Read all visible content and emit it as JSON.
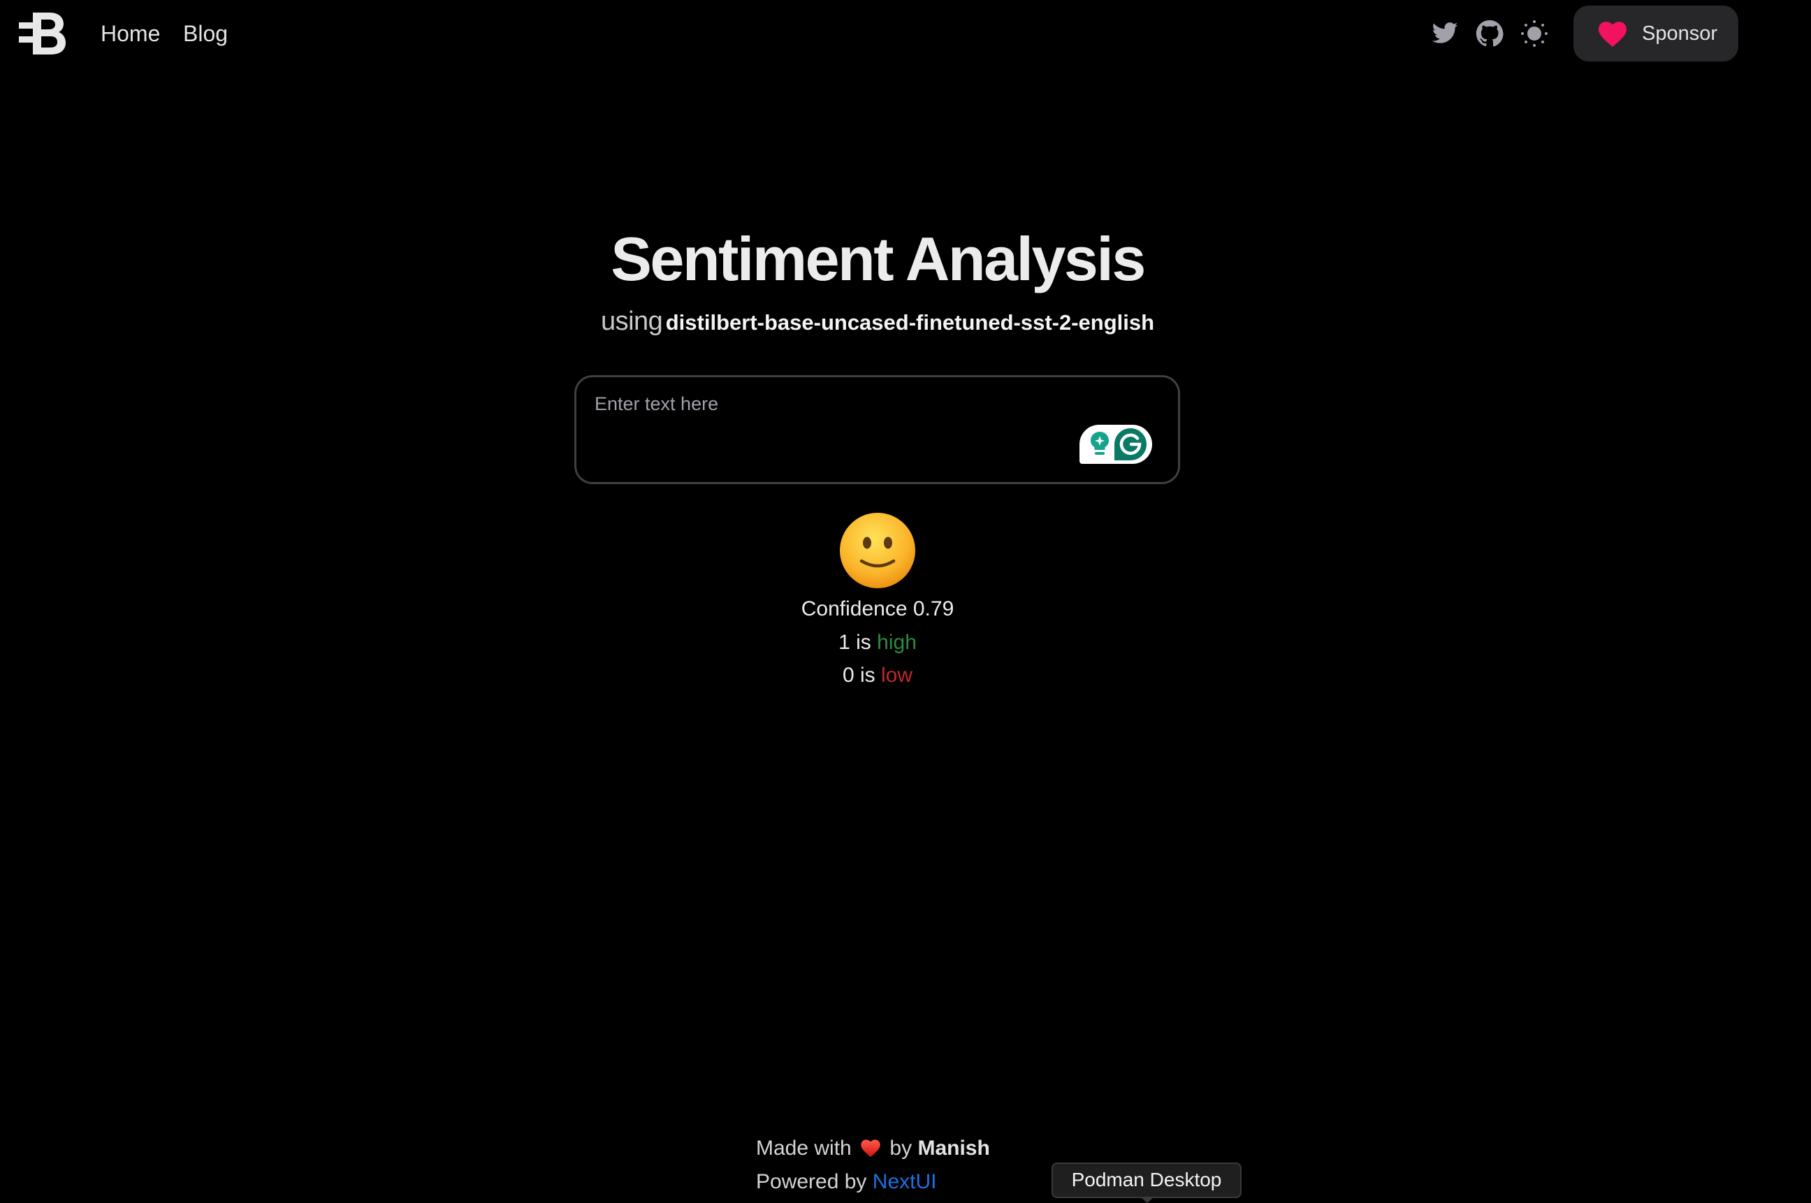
{
  "header": {
    "logo_icon": "letter-b-logo-icon",
    "nav": [
      {
        "label": "Home"
      },
      {
        "label": "Blog"
      }
    ],
    "icons": [
      "twitter-icon",
      "github-icon",
      "theme-toggle-sun-icon"
    ],
    "sponsor": {
      "label": "Sponsor",
      "icon": "heart-icon",
      "heart_color": "#f31260"
    }
  },
  "main": {
    "title": "Sentiment Analysis",
    "subtitle_prefix": "using",
    "model_name": "distilbert-base-uncased-finetuned-sst-2-english",
    "input": {
      "value": "",
      "placeholder": "Enter text here",
      "extension_widget": "grammarly-widget"
    },
    "result": {
      "emoji": "slightly-smiling-face",
      "confidence_label": "Confidence",
      "confidence_value": "0.79",
      "high_prefix": "1 is",
      "high_word": "high",
      "high_color": "#2f8a3c",
      "low_prefix": "0 is",
      "low_word": "low",
      "low_color": "#c0282a"
    }
  },
  "footer": {
    "made_with_prefix": "Made with",
    "made_with_icon": "red-heart-emoji",
    "by_text": "by",
    "author": "Manish",
    "powered_by_prefix": "Powered by",
    "powered_by_link": "NextUI",
    "link_color": "#1e6fe0"
  },
  "tooltip": {
    "text": "Podman Desktop"
  }
}
